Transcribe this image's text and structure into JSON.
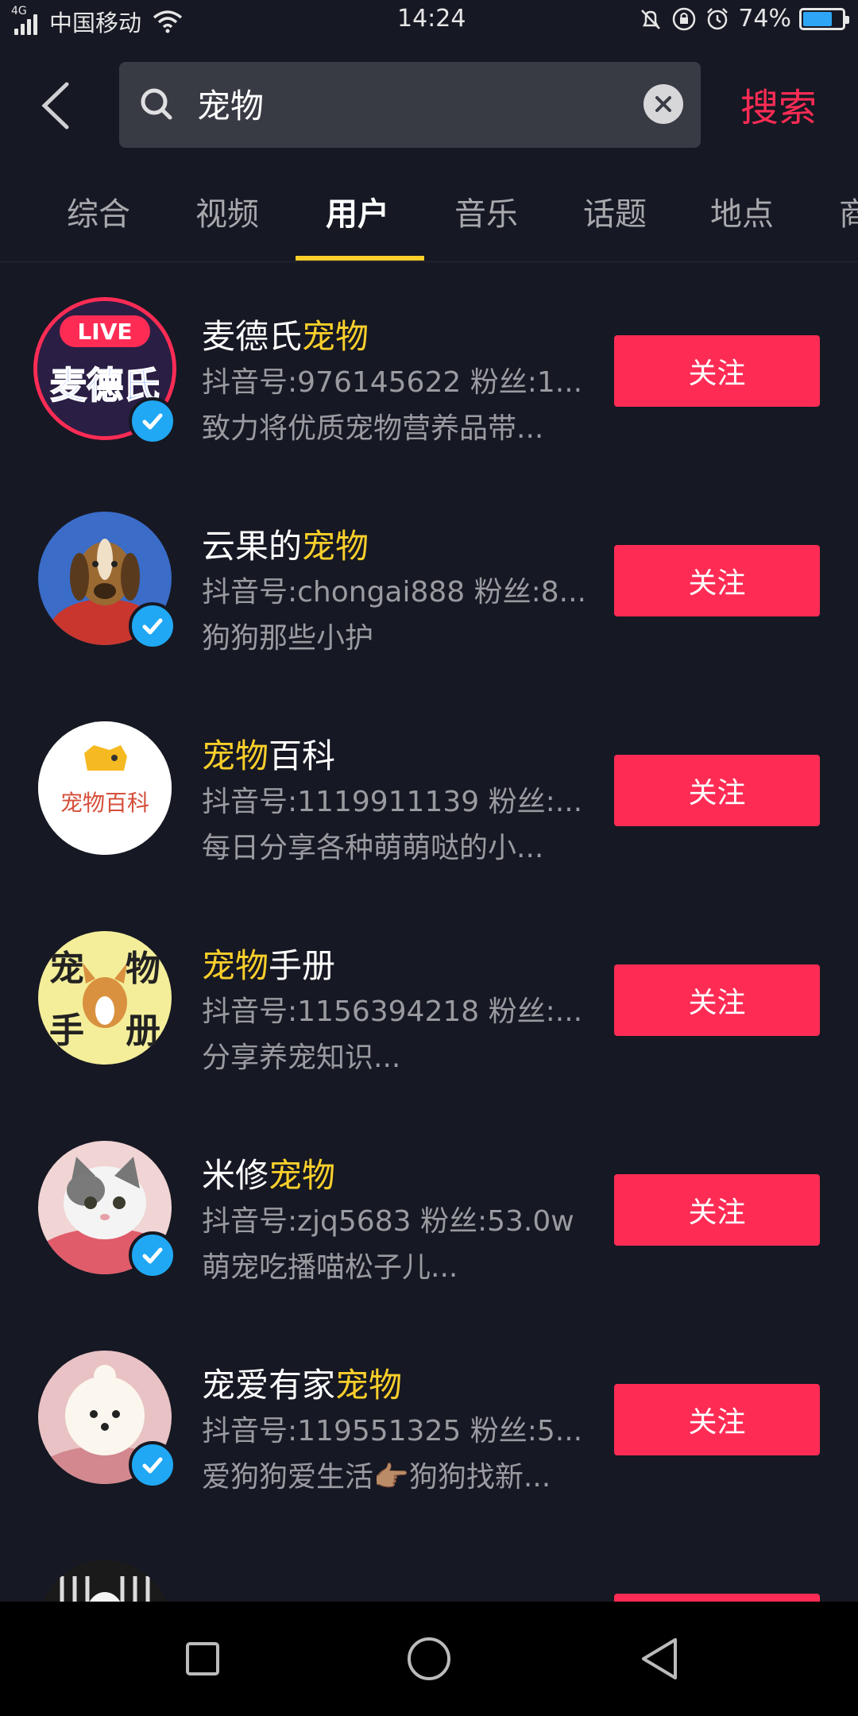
{
  "status_bar": {
    "network": "4G",
    "carrier": "中国移动",
    "time": "14:24",
    "battery": "74%",
    "battery_level": 0.74
  },
  "search": {
    "query": "宠物",
    "submit_label": "搜索"
  },
  "tabs": [
    {
      "label": "综合"
    },
    {
      "label": "视频"
    },
    {
      "label": "用户"
    },
    {
      "label": "音乐"
    },
    {
      "label": "话题"
    },
    {
      "label": "地点"
    },
    {
      "label": "商"
    }
  ],
  "active_tab": "用户",
  "users": [
    {
      "name_pre": "麦德氏",
      "name_hl": "宠物",
      "name_post": "",
      "meta": "抖音号:976145622 粉丝:1...",
      "desc": "致力将优质宠物营养品带...",
      "follow_label": "关注",
      "avatar_text": "麦德氏",
      "live_badge": "LIVE"
    },
    {
      "name_pre": "云果的",
      "name_hl": "宠物",
      "name_post": "",
      "meta": "抖音号:chongai888 粉丝:8...",
      "desc": "狗狗那些小护",
      "follow_label": "关注"
    },
    {
      "name_pre": "",
      "name_hl": "宠物",
      "name_post": "百科",
      "meta": "抖音号:1119911139 粉丝:...",
      "desc": "每日分享各种萌萌哒的小...",
      "follow_label": "关注",
      "avatar_text": "宠物百科"
    },
    {
      "name_pre": "",
      "name_hl": "宠物",
      "name_post": "手册",
      "meta": "抖音号:1156394218 粉丝:...",
      "desc": "分享养宠知识...",
      "follow_label": "关注",
      "avatar_text_1": "宠",
      "avatar_text_2": "物",
      "avatar_text_3": "手",
      "avatar_text_4": "册"
    },
    {
      "name_pre": "米修",
      "name_hl": "宠物",
      "name_post": "",
      "meta": "抖音号:zjq5683 粉丝:53.0w",
      "desc": "萌宠吃播喵松子儿...",
      "follow_label": "关注"
    },
    {
      "name_pre": "宠爱有家",
      "name_hl": "宠物",
      "name_post": "",
      "meta": "抖音号:119551325 粉丝:5...",
      "desc": "爱狗狗爱生活👉🏽狗狗找新...",
      "follow_label": "关注"
    }
  ],
  "colors": {
    "background": "#161823",
    "accent": "#fe2c55",
    "highlight": "#facf2b",
    "verified": "#20a8f4"
  }
}
